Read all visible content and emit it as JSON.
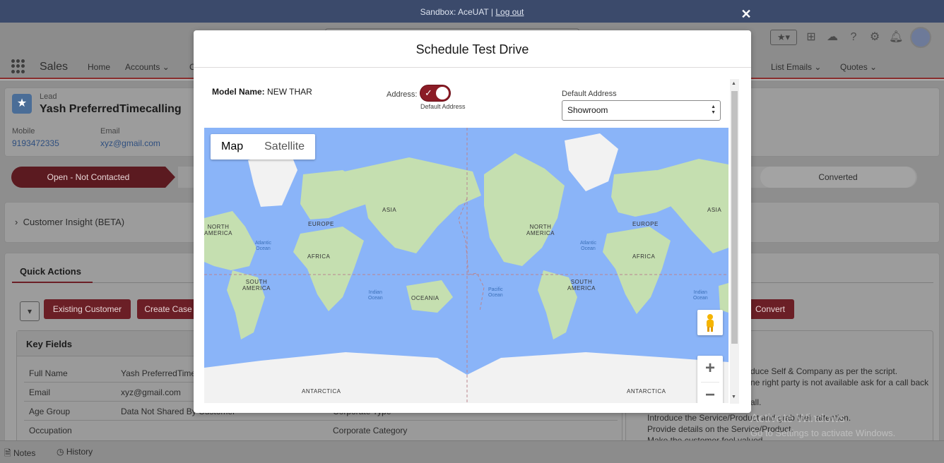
{
  "sandbox": {
    "text": "Sandbox: AceUAT |",
    "logout": "Log out"
  },
  "nav": {
    "app_name": "Sales",
    "items": [
      "Home",
      "Accounts",
      "C",
      "List Emails",
      "Quotes"
    ]
  },
  "record": {
    "type_label": "Lead",
    "name": "Yash PreferredTimecalling",
    "mobile_label": "Mobile",
    "mobile_value": "9193472335",
    "email_label": "Email",
    "email_value": "xyz@gmail.com"
  },
  "path": {
    "active": "Open - Not Contacted",
    "last": "Converted"
  },
  "insight": {
    "label": "Customer Insight (BETA)"
  },
  "quick_actions": {
    "title": "Quick Actions",
    "existing_customer": "Existing Customer",
    "create_case": "Create Case",
    "convert": "Convert"
  },
  "key_fields": {
    "title": "Key Fields",
    "rows": [
      {
        "label": "Full Name",
        "value": "Yash PreferredTime"
      },
      {
        "label": "Email",
        "value": "xyz@gmail.com"
      },
      {
        "label": "Age Group",
        "value": "Data Not Shared By Customer"
      },
      {
        "label": "Occupation",
        "value": ""
      }
    ],
    "right_labels": [
      "Corporate Type",
      "Corporate Category"
    ]
  },
  "script_text": {
    "lines": [
      "duce Self & Company as per the script.",
      "ne right party is not available ask for a call back",
      "all.",
      "Introduce the Service/Product and grab their attention.",
      "Provide details on the Service/Product.",
      "Make the customer feel valued."
    ]
  },
  "watermark": {
    "line1": "Activate Windows",
    "line2": "Go to Settings to activate Windows."
  },
  "utility": {
    "notes": "Notes",
    "history": "History"
  },
  "modal": {
    "title": "Schedule Test Drive",
    "model_label": "Model Name:",
    "model_value": "NEW THAR",
    "address_label": "Address:",
    "toggle_sublabel": "Default Address",
    "default_address_label": "Default Address",
    "default_address_value": "Showroom",
    "map_type_map": "Map",
    "map_type_satellite": "Satellite",
    "map_labels": {
      "north_america": "NORTH\nAMERICA",
      "north_america_left": "NORTH\nAMERICA",
      "europe": "EUROPE",
      "asia": "ASIA",
      "africa": "AFRICA",
      "south_america": "SOUTH\nAMERICA",
      "oceania": "OCEANIA",
      "antarctica": "ANTARCTICA",
      "atlantic": "Atlantic\nOcean",
      "indian": "Indian\nOcean",
      "pacific": "Pacific\nOcean"
    },
    "zoom_in": "+",
    "zoom_out": "−"
  },
  "colors": {
    "brand": "#8b1c26",
    "ocean": "#8ab4f8",
    "land": "#c5dfb0"
  }
}
